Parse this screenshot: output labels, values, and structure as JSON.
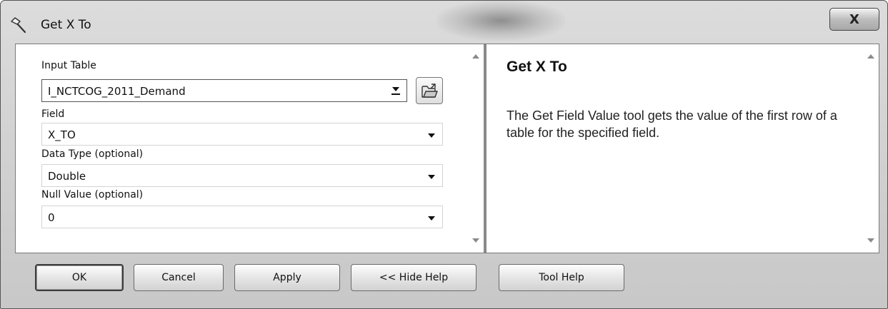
{
  "window": {
    "title": "Get X To",
    "close_label": "X"
  },
  "params": {
    "input_table_label": "Input Table",
    "input_table_value": "I_NCTCOG_2011_Demand",
    "field_label": "Field",
    "field_value": "X_TO",
    "data_type_label": "Data Type (optional)",
    "data_type_value": "Double",
    "null_value_label": "Null Value (optional)",
    "null_value_value": "0"
  },
  "help": {
    "title": "Get X To",
    "body": "The Get Field Value tool gets the value of the first row of a table for the specified field."
  },
  "buttons": {
    "ok": "OK",
    "cancel": "Cancel",
    "apply": "Apply",
    "hide_help": "<< Hide Help",
    "tool_help": "Tool Help"
  },
  "icons": {
    "title": "hammer-icon",
    "browse": "open-folder-icon",
    "combo_arrow": "chevron-down-icon"
  }
}
